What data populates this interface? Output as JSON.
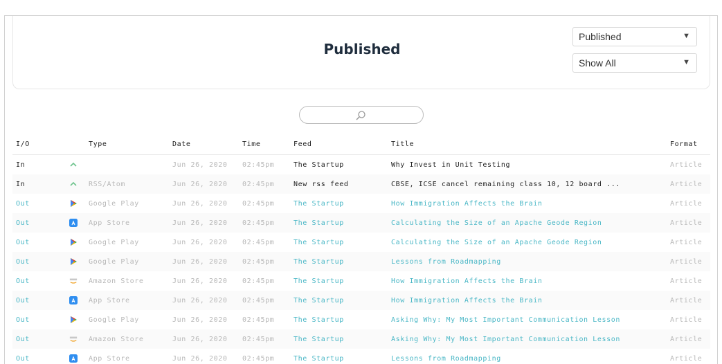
{
  "header": {
    "title": "Published",
    "status_select": "Published",
    "filter_select": "Show All"
  },
  "table": {
    "columns": [
      "I/O",
      "",
      "Type",
      "Date",
      "Time",
      "Feed",
      "Title",
      "Format"
    ],
    "rows": [
      {
        "io": "In",
        "icon": "rss-chevron-icon",
        "type": "",
        "date": "Jun 26, 2020",
        "time": "02:45pm",
        "feed": "The Startup",
        "title": "Why Invest in Unit Testing",
        "format": "Article"
      },
      {
        "io": "In",
        "icon": "rss-chevron-icon",
        "type": "RSS/Atom",
        "date": "Jun 26, 2020",
        "time": "02:45pm",
        "feed": "New rss feed",
        "title": "CBSE, ICSE cancel remaining class 10, 12 board ...",
        "format": "Article"
      },
      {
        "io": "Out",
        "icon": "google-play-icon",
        "type": "Google Play",
        "date": "Jun 26, 2020",
        "time": "02:45pm",
        "feed": "The Startup",
        "title": "How Immigration Affects the Brain",
        "format": "Article"
      },
      {
        "io": "Out",
        "icon": "app-store-icon",
        "type": "App Store",
        "date": "Jun 26, 2020",
        "time": "02:45pm",
        "feed": "The Startup",
        "title": "Calculating the Size of an Apache Geode Region",
        "format": "Article"
      },
      {
        "io": "Out",
        "icon": "google-play-icon",
        "type": "Google Play",
        "date": "Jun 26, 2020",
        "time": "02:45pm",
        "feed": "The Startup",
        "title": "Calculating the Size of an Apache Geode Region",
        "format": "Article"
      },
      {
        "io": "Out",
        "icon": "google-play-icon",
        "type": "Google Play",
        "date": "Jun 26, 2020",
        "time": "02:45pm",
        "feed": "The Startup",
        "title": "Lessons from Roadmapping",
        "format": "Article"
      },
      {
        "io": "Out",
        "icon": "amazon-store-icon",
        "type": "Amazon Store",
        "date": "Jun 26, 2020",
        "time": "02:45pm",
        "feed": "The Startup",
        "title": "How Immigration Affects the Brain",
        "format": "Article"
      },
      {
        "io": "Out",
        "icon": "app-store-icon",
        "type": "App Store",
        "date": "Jun 26, 2020",
        "time": "02:45pm",
        "feed": "The Startup",
        "title": "How Immigration Affects the Brain",
        "format": "Article"
      },
      {
        "io": "Out",
        "icon": "google-play-icon",
        "type": "Google Play",
        "date": "Jun 26, 2020",
        "time": "02:45pm",
        "feed": "The Startup",
        "title": "Asking Why: My Most Important Communication Lesson",
        "format": "Article"
      },
      {
        "io": "Out",
        "icon": "amazon-store-icon",
        "type": "Amazon Store",
        "date": "Jun 26, 2020",
        "time": "02:45pm",
        "feed": "The Startup",
        "title": "Asking Why: My Most Important Communication Lesson",
        "format": "Article"
      },
      {
        "io": "Out",
        "icon": "app-store-icon",
        "type": "App Store",
        "date": "Jun 26, 2020",
        "time": "02:45pm",
        "feed": "The Startup",
        "title": "Lessons from Roadmapping",
        "format": "Article"
      }
    ]
  },
  "colors": {
    "title": "#1f2d3d",
    "link": "#4ab7c6",
    "muted": "#b8b8b8",
    "rss_green": "#6cc38c",
    "app_store_blue": "#2f8ef0"
  }
}
